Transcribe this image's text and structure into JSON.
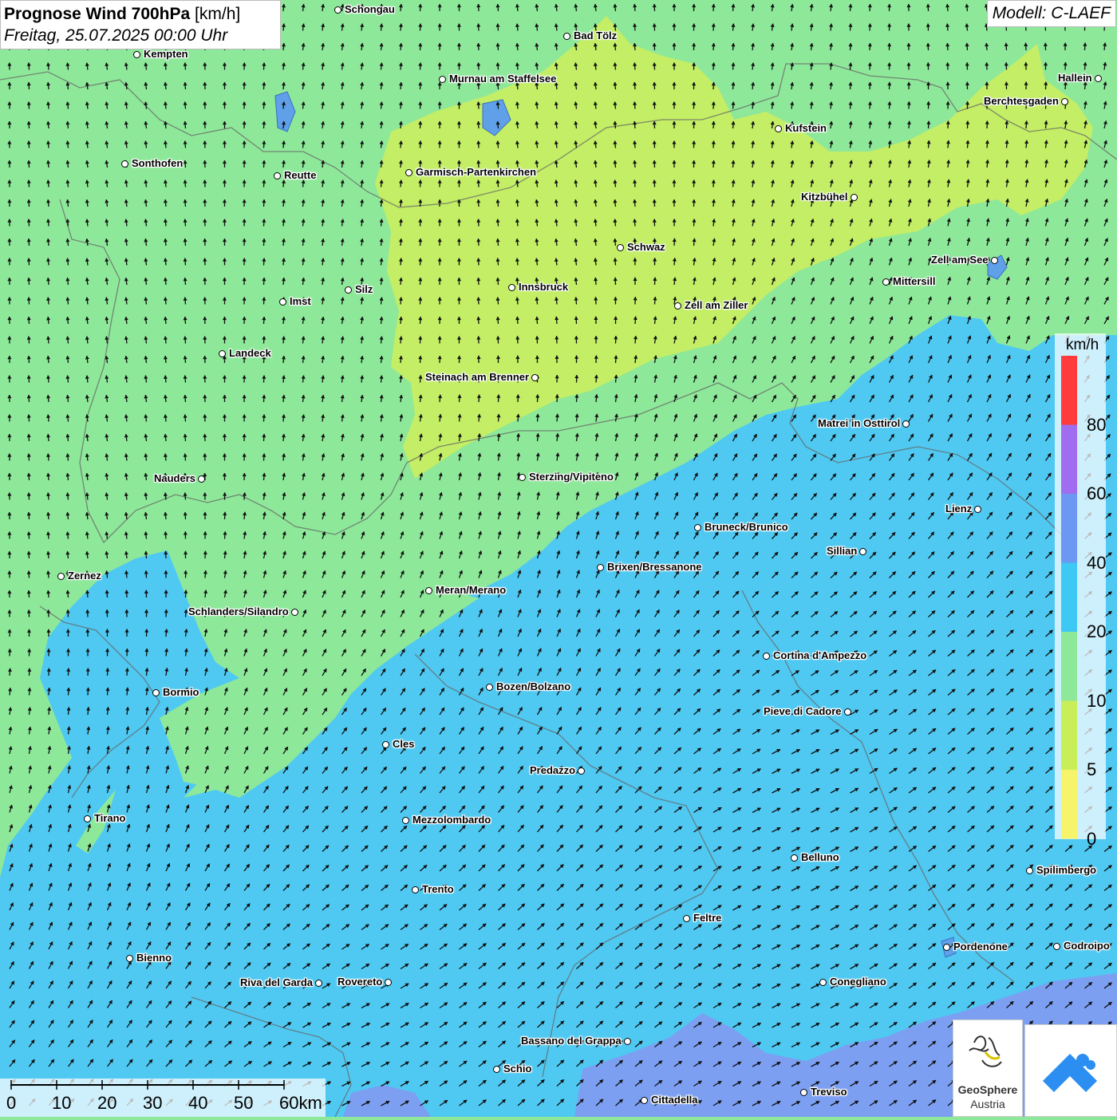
{
  "header": {
    "title_bold": "Prognose Wind 700hPa",
    "title_unit": "[km/h]",
    "datetime": "Freitag, 25.07.2025 00:00 Uhr",
    "model": "Modell: C-LAEF"
  },
  "legend": {
    "unit": "km/h",
    "ticks": [
      "80",
      "60",
      "40",
      "20",
      "10",
      "5",
      "0"
    ],
    "colors": [
      "#ff3b3b",
      "#a06cf0",
      "#6c98f4",
      "#3ec8f4",
      "#8ee89a",
      "#c8ef5a",
      "#f6f46a"
    ],
    "classes": [
      "0-5",
      "5-10",
      "10-20",
      "20-40",
      "40-60",
      "60-80",
      ">80"
    ]
  },
  "map": {
    "base_color": "#8ee89a",
    "cities": [
      {
        "name": "Schongau",
        "id": "schongau"
      },
      {
        "name": "Bad Tölz",
        "id": "bad-toelz"
      },
      {
        "name": "Kempten",
        "id": "kempten"
      },
      {
        "name": "Murnau am Staffelsee",
        "id": "murnau"
      },
      {
        "name": "Hallein",
        "id": "hallein"
      },
      {
        "name": "Berchtesgaden",
        "id": "berchtesgaden"
      },
      {
        "name": "Kufstein",
        "id": "kufstein"
      },
      {
        "name": "Sonthofen",
        "id": "sonthofen"
      },
      {
        "name": "Reutte",
        "id": "reutte"
      },
      {
        "name": "Garmisch-Partenkirchen",
        "id": "garmisch"
      },
      {
        "name": "Kitzbühel",
        "id": "kitzbuehel"
      },
      {
        "name": "Schwaz",
        "id": "schwaz"
      },
      {
        "name": "Zell am See",
        "id": "zell-am-see"
      },
      {
        "name": "Mittersill",
        "id": "mittersill"
      },
      {
        "name": "Silz",
        "id": "silz"
      },
      {
        "name": "Innsbruck",
        "id": "innsbruck"
      },
      {
        "name": "Imst",
        "id": "imst"
      },
      {
        "name": "Zell am Ziller",
        "id": "zell-am-ziller"
      },
      {
        "name": "Landeck",
        "id": "landeck"
      },
      {
        "name": "Steinach am Brenner",
        "id": "steinach"
      },
      {
        "name": "Matrei in Osttirol",
        "id": "matrei"
      },
      {
        "name": "Nauders",
        "id": "nauders"
      },
      {
        "name": "Sterzing/Vipiteno",
        "id": "sterzing"
      },
      {
        "name": "Lienz",
        "id": "lienz"
      },
      {
        "name": "Bruneck/Brunico",
        "id": "bruneck"
      },
      {
        "name": "Sillian",
        "id": "sillian"
      },
      {
        "name": "Zernez",
        "id": "zernez"
      },
      {
        "name": "Brixen/Bressanone",
        "id": "brixen"
      },
      {
        "name": "Meran/Merano",
        "id": "meran"
      },
      {
        "name": "Schlanders/Silandro",
        "id": "schlanders"
      },
      {
        "name": "Cortina d'Ampezzo",
        "id": "cortina"
      },
      {
        "name": "Bozen/Bolzano",
        "id": "bozen"
      },
      {
        "name": "Bormio",
        "id": "bormio"
      },
      {
        "name": "Pieve di Cadore",
        "id": "pieve"
      },
      {
        "name": "Cles",
        "id": "cles"
      },
      {
        "name": "Predazzo",
        "id": "predazzo"
      },
      {
        "name": "Tirano",
        "id": "tirano"
      },
      {
        "name": "Mezzolombardo",
        "id": "mezzolombardo"
      },
      {
        "name": "Belluno",
        "id": "belluno"
      },
      {
        "name": "Spilimbergo",
        "id": "spilimbergo"
      },
      {
        "name": "Trento",
        "id": "trento"
      },
      {
        "name": "Feltre",
        "id": "feltre"
      },
      {
        "name": "Bienno",
        "id": "bienno"
      },
      {
        "name": "Pordenone",
        "id": "pordenone"
      },
      {
        "name": "Codroipo",
        "id": "codroipo"
      },
      {
        "name": "Riva del Garda",
        "id": "riva"
      },
      {
        "name": "Rovereto",
        "id": "rovereto"
      },
      {
        "name": "Conegliano",
        "id": "conegliano"
      },
      {
        "name": "Bassano del Grappa",
        "id": "bassano"
      },
      {
        "name": "Schio",
        "id": "schio"
      },
      {
        "name": "Treviso",
        "id": "treviso"
      },
      {
        "name": "Cittadella",
        "id": "cittadella"
      }
    ]
  },
  "scale": {
    "labels": [
      "0",
      "10",
      "20",
      "30",
      "40",
      "50",
      "60km"
    ]
  },
  "logos": {
    "geosphere_line1": "GeoSphere",
    "geosphere_line2": "Austria"
  }
}
